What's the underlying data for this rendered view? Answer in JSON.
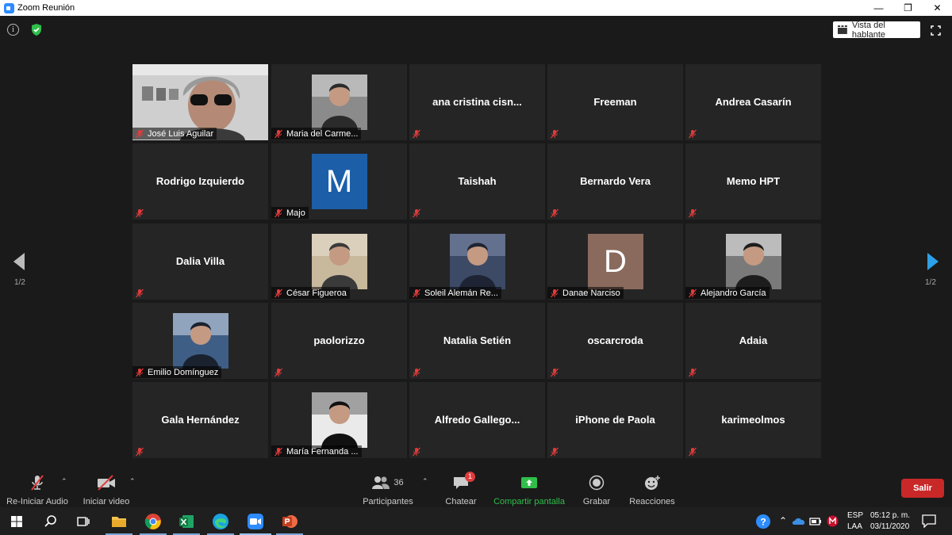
{
  "window": {
    "title": "Zoom Reunión"
  },
  "top": {
    "speaker_view_label": "Vista del hablante"
  },
  "pager": {
    "left": "1/2",
    "right": "1/2"
  },
  "participants": [
    {
      "name": "José Luis Aguilar",
      "style": "photo",
      "active": true
    },
    {
      "name": "Maria del Carme...",
      "style": "photo"
    },
    {
      "name": "ana  cristina  cisn...",
      "style": "text"
    },
    {
      "name": "Freeman",
      "style": "text"
    },
    {
      "name": "Andrea Casarín",
      "style": "text"
    },
    {
      "name": "Rodrigo Izquierdo",
      "style": "text"
    },
    {
      "name": "Majo",
      "style": "letter",
      "letter": "M",
      "color": "#1c5fa8"
    },
    {
      "name": "Taishah",
      "style": "text"
    },
    {
      "name": "Bernardo Vera",
      "style": "text"
    },
    {
      "name": "Memo HPT",
      "style": "text"
    },
    {
      "name": "Dalia Villa",
      "style": "text"
    },
    {
      "name": "César Figueroa",
      "style": "photo"
    },
    {
      "name": "Soleil Alemán Re...",
      "style": "photo"
    },
    {
      "name": "Danae Narciso",
      "style": "letter",
      "letter": "D",
      "color": "#8a6a5d"
    },
    {
      "name": "Alejandro García",
      "style": "photo"
    },
    {
      "name": "Emilio Domínguez",
      "style": "photo"
    },
    {
      "name": "paolorizzo",
      "style": "text"
    },
    {
      "name": "Natalia Setién",
      "style": "text"
    },
    {
      "name": "oscarcroda",
      "style": "text"
    },
    {
      "name": "Adaia",
      "style": "text"
    },
    {
      "name": "Gala Hernández",
      "style": "text"
    },
    {
      "name": "María Fernanda ...",
      "style": "photo"
    },
    {
      "name": "Alfredo  Gallego...",
      "style": "text"
    },
    {
      "name": "iPhone de Paola",
      "style": "text"
    },
    {
      "name": "karimeolmos",
      "style": "text"
    }
  ],
  "toolbar": {
    "audio": "Re-Iniciar Audio",
    "video": "Iniciar video",
    "participants": "Participantes",
    "participants_count": "36",
    "chat": "Chatear",
    "chat_badge": "1",
    "share": "Compartir pantalla",
    "record": "Grabar",
    "reactions": "Reacciones",
    "leave": "Salir"
  },
  "taskbar": {
    "lang1": "ESP",
    "lang2": "LAA",
    "time": "05:12 p. m.",
    "date": "03/11/2020"
  },
  "colors": {
    "accent_green": "#2fbf4a",
    "leave_red": "#c82828",
    "active_border": "#d7e89a",
    "nav_blue": "#2da0e8"
  }
}
